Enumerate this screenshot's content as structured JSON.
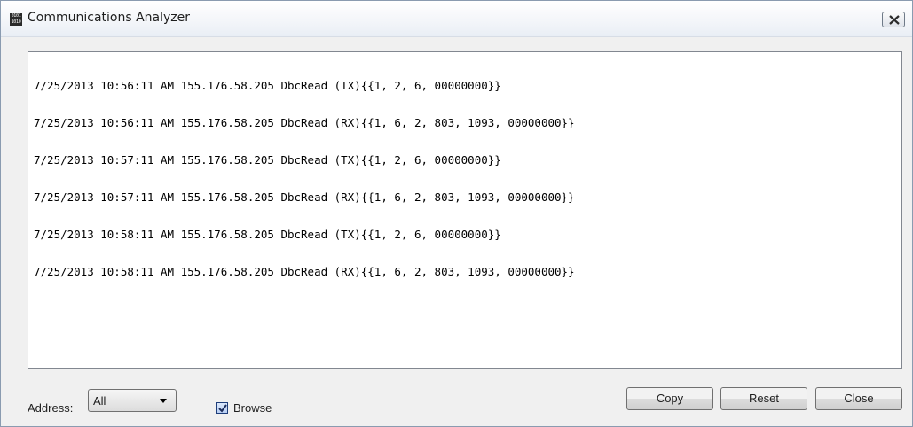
{
  "window": {
    "title": "Communications Analyzer",
    "icon_text": "0101\n1010",
    "close_icon": "close-icon"
  },
  "log": {
    "lines": [
      "7/25/2013 10:56:11 AM 155.176.58.205 DbcRead (TX){{1, 2, 6, 00000000}}",
      "7/25/2013 10:56:11 AM 155.176.58.205 DbcRead (RX){{1, 6, 2, 803, 1093, 00000000}}",
      "7/25/2013 10:57:11 AM 155.176.58.205 DbcRead (TX){{1, 2, 6, 00000000}}",
      "7/25/2013 10:57:11 AM 155.176.58.205 DbcRead (RX){{1, 6, 2, 803, 1093, 00000000}}",
      "7/25/2013 10:58:11 AM 155.176.58.205 DbcRead (TX){{1, 2, 6, 00000000}}",
      "7/25/2013 10:58:11 AM 155.176.58.205 DbcRead (RX){{1, 6, 2, 803, 1093, 00000000}}"
    ]
  },
  "footer": {
    "address_label": "Address:",
    "address_value": "All",
    "browse_label": "Browse",
    "browse_checked": true,
    "copy_label": "Copy",
    "reset_label": "Reset",
    "close_label": "Close"
  }
}
